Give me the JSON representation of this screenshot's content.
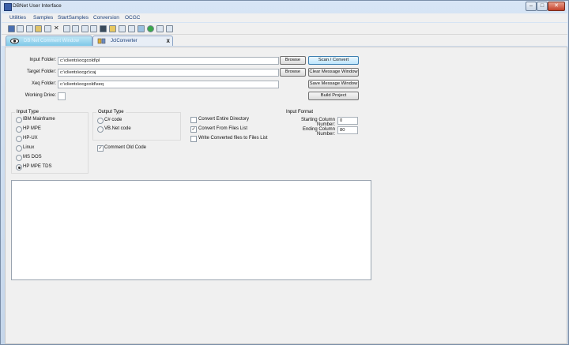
{
  "window": {
    "title": "DBNet User Interface"
  },
  "menu": [
    "Utilities",
    "Samples",
    "StartSamples",
    "Conversion",
    "OCGC"
  ],
  "tabs": [
    {
      "label": "DB Net Comment Window"
    },
    {
      "label": "JclConverter",
      "close": "x"
    }
  ],
  "form": {
    "input_folder": {
      "label": "Input Folder:",
      "value": "c:\\clients\\ocgcold\\pl"
    },
    "target_folder": {
      "label": "Target Folder:",
      "value": "c:\\clients\\ocgc\\caj"
    },
    "xeq_folder": {
      "label": "Xeq Folder:",
      "value": "c:\\clients\\ocgcold\\xeq"
    },
    "working_drive": {
      "label": "Working Drive:",
      "value": ""
    },
    "browse_label": "Browse"
  },
  "buttons": {
    "scan_convert": "Scan / Convert",
    "clear_message": "Clear Message Window",
    "save_message": "Save Message Window",
    "build_project": "Build Project"
  },
  "input_type": {
    "title": "Input Type",
    "options": [
      "IBM Mainframe",
      "HP MPE",
      "HP-UX",
      "Linux",
      "MS DOS",
      "HP MPE TDS"
    ],
    "selected": "HP MPE TDS"
  },
  "output_type": {
    "title": "Output Type",
    "options": [
      "C# code",
      "VB.Net code"
    ]
  },
  "comment_old_code": {
    "label": "Comment Old Code",
    "checked": true
  },
  "convert_options": [
    {
      "label": "Convert Entire Directory",
      "checked": false
    },
    {
      "label": "Convert From Files List",
      "checked": true
    },
    {
      "label": "Write Converted files to Files List",
      "checked": false
    }
  ],
  "input_format": {
    "title": "Input Format",
    "start_label": "Starting Column Number:",
    "start_value": "0",
    "end_label": "Ending Column Number:",
    "end_value": "80"
  },
  "message_window": {
    "text": ""
  },
  "colors": {
    "accent": "#3c7fb1",
    "tab_active": "#7ec8e8",
    "window_bg": "#c9d9ec",
    "panel_bg": "#f0f0f0"
  }
}
